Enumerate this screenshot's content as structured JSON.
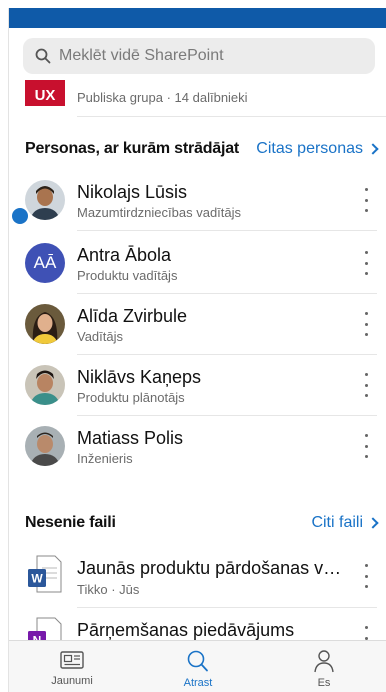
{
  "search": {
    "placeholder": "Meklēt vidē SharePoint"
  },
  "group": {
    "tile_text": "UX",
    "subtitle": "Publiska grupa · 14 dalībnieki"
  },
  "people_section": {
    "title": "Personas, ar kurām strādājat",
    "link": "Citas personas",
    "people": [
      {
        "name": "Nikolajs Lūsis",
        "role": "Mazumtirdzniecības vadītājs",
        "unread": true
      },
      {
        "name": "Antra Ābola",
        "role": "Produktu vadītājs",
        "initials": "AĀ"
      },
      {
        "name": "Alīda Zvirbule",
        "role": "Vadītājs"
      },
      {
        "name": "Niklāvs Kaņeps",
        "role": "Produktu plānotājs"
      },
      {
        "name": "Matiass Polis",
        "role": "Inženieris"
      }
    ]
  },
  "files_section": {
    "title": "Nesenie faili",
    "link": "Citi faili",
    "files": [
      {
        "name": "Jaunās produktu pārdošanas va...",
        "meta": "Tikko · Jūs",
        "type": "word-icon",
        "letter": "W"
      },
      {
        "name": "Pārņemšanas piedāvājums",
        "meta": "",
        "type": "onenote-icon",
        "letter": "N"
      }
    ]
  },
  "tabs": [
    {
      "label": "Jaunumi",
      "icon": "news-icon",
      "active": false
    },
    {
      "label": "Atrast",
      "icon": "search-icon",
      "active": true
    },
    {
      "label": "Es",
      "icon": "person-icon",
      "active": false
    }
  ],
  "colors": {
    "accent": "#1a73c7",
    "topbar": "#0f5aa8",
    "ux_tile": "#c8102e",
    "avatar_initials_bg": "#3f51b5",
    "word": "#2b579a",
    "onenote": "#7719aa"
  }
}
